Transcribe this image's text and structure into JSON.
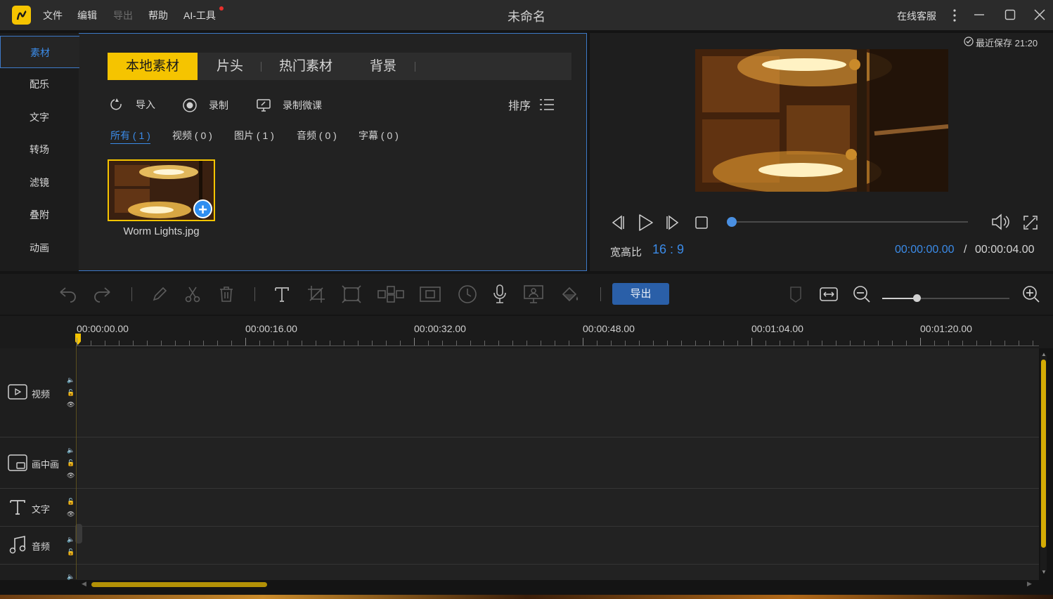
{
  "window": {
    "title": "未命名",
    "support_label": "在线客服"
  },
  "menu": {
    "file": "文件",
    "edit": "编辑",
    "export": "导出",
    "help": "帮助",
    "ai_tools": "AI-工具"
  },
  "sidebar": {
    "items": [
      {
        "label": "素材",
        "active": true
      },
      {
        "label": "配乐"
      },
      {
        "label": "文字"
      },
      {
        "label": "转场"
      },
      {
        "label": "滤镜"
      },
      {
        "label": "叠附"
      },
      {
        "label": "动画"
      }
    ]
  },
  "media": {
    "tabs": [
      "本地素材",
      "片头",
      "热门素材",
      "背景"
    ],
    "actions": {
      "import": "导入",
      "record": "录制",
      "record_lesson": "录制微课",
      "sort": "排序"
    },
    "filters": [
      "所有 ( 1 )",
      "视频 ( 0 )",
      "图片 ( 1 )",
      "音频 ( 0 )",
      "字幕 ( 0 )"
    ],
    "items": [
      {
        "name": "Worm Lights.jpg"
      }
    ]
  },
  "preview": {
    "save_status": "最近保存 21:20",
    "aspect_label": "宽高比",
    "aspect_value": "16 : 9",
    "current_time": "00:00:00.00",
    "separator": "/",
    "total_time": "00:00:04.00",
    "progress": 0
  },
  "timeline": {
    "export_label": "导出",
    "ruler_labels": [
      "00:00:00.00",
      "00:00:16.00",
      "00:00:32.00",
      "00:00:48.00",
      "00:01:04.00",
      "00:01:20.00"
    ],
    "tracks": [
      {
        "label": "视频"
      },
      {
        "label": "画中画"
      },
      {
        "label": "文字"
      },
      {
        "label": "音频"
      }
    ],
    "zoom_level": 0.27
  },
  "colors": {
    "accent": "#f5c400",
    "link_blue": "#3b8be8",
    "panel_border": "#3d79c8",
    "export_button": "#2a5fa8"
  }
}
